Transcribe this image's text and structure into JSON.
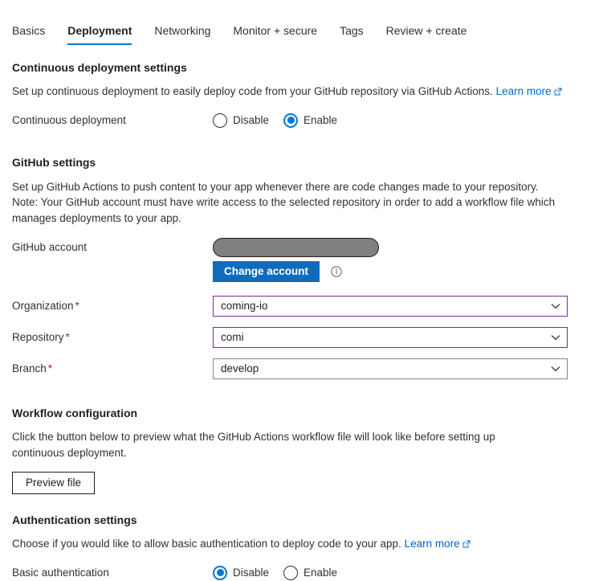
{
  "tabs": [
    {
      "label": "Basics",
      "active": false
    },
    {
      "label": "Deployment",
      "active": true
    },
    {
      "label": "Networking",
      "active": false
    },
    {
      "label": "Monitor + secure",
      "active": false
    },
    {
      "label": "Tags",
      "active": false
    },
    {
      "label": "Review + create",
      "active": false
    }
  ],
  "continuous_deployment": {
    "section_title": "Continuous deployment settings",
    "description": "Set up continuous deployment to easily deploy code from your GitHub repository via GitHub Actions.",
    "learn_more": "Learn more",
    "field_label": "Continuous deployment",
    "options": [
      {
        "label": "Disable",
        "selected": false
      },
      {
        "label": "Enable",
        "selected": true
      }
    ]
  },
  "github_settings": {
    "section_title": "GitHub settings",
    "description": "Set up GitHub Actions to push content to your app whenever there are code changes made to your repository. Note: Your GitHub account must have write access to the selected repository in order to add a workflow file which manages deployments to your app.",
    "account_label": "GitHub account",
    "account_value": "",
    "change_account_label": "Change account",
    "info_tooltip_icon": "info-circle-icon",
    "fields": [
      {
        "label": "Organization",
        "required": true,
        "value": "coming-io",
        "accent": true
      },
      {
        "label": "Repository",
        "required": true,
        "value": "comi",
        "accent": true
      },
      {
        "label": "Branch",
        "required": true,
        "value": "develop",
        "accent": false
      }
    ]
  },
  "workflow_configuration": {
    "section_title": "Workflow configuration",
    "description": "Click the button below to preview what the GitHub Actions workflow file will look like before setting up continuous deployment.",
    "preview_button_label": "Preview file"
  },
  "authentication_settings": {
    "section_title": "Authentication settings",
    "description": "Choose if you would like to allow basic authentication to deploy code to your app.",
    "learn_more": "Learn more",
    "field_label": "Basic authentication",
    "options": [
      {
        "label": "Disable",
        "selected": true
      },
      {
        "label": "Enable",
        "selected": false
      }
    ]
  },
  "colors": {
    "accent_blue": "#0078d4",
    "primary_button": "#0f6cbd",
    "link": "#0066cc",
    "required_asterisk": "#a4262c",
    "field_accent_border": "#7d2a9e",
    "redaction": "#808080"
  }
}
